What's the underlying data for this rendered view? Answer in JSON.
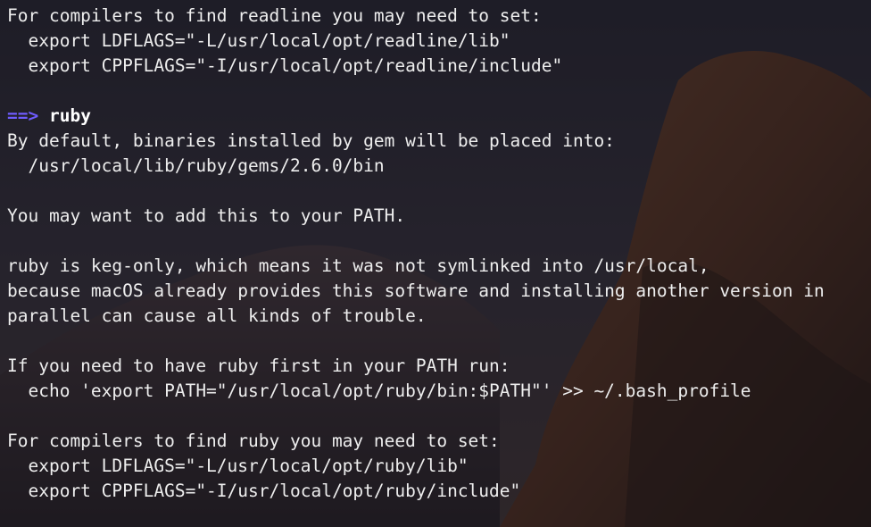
{
  "terminal": {
    "colors": {
      "text": "#eeeeee",
      "arrow": "#6f5cff",
      "package_name": "#ffffff"
    },
    "lines": [
      "For compilers to find readline you may need to set:",
      "  export LDFLAGS=\"-L/usr/local/opt/readline/lib\"",
      "  export CPPFLAGS=\"-I/usr/local/opt/readline/include\"",
      "",
      "By default, binaries installed by gem will be placed into:",
      "  /usr/local/lib/ruby/gems/2.6.0/bin",
      "",
      "You may want to add this to your PATH.",
      "",
      "ruby is keg-only, which means it was not symlinked into /usr/local,",
      "because macOS already provides this software and installing another version in",
      "parallel can cause all kinds of trouble.",
      "",
      "If you need to have ruby first in your PATH run:",
      "  echo 'export PATH=\"/usr/local/opt/ruby/bin:$PATH\"' >> ~/.bash_profile",
      "",
      "For compilers to find ruby you may need to set:",
      "  export LDFLAGS=\"-L/usr/local/opt/ruby/lib\"",
      "  export CPPFLAGS=\"-I/usr/local/opt/ruby/include\""
    ],
    "caveat_header": {
      "arrow": "==>",
      "package": "ruby"
    }
  }
}
